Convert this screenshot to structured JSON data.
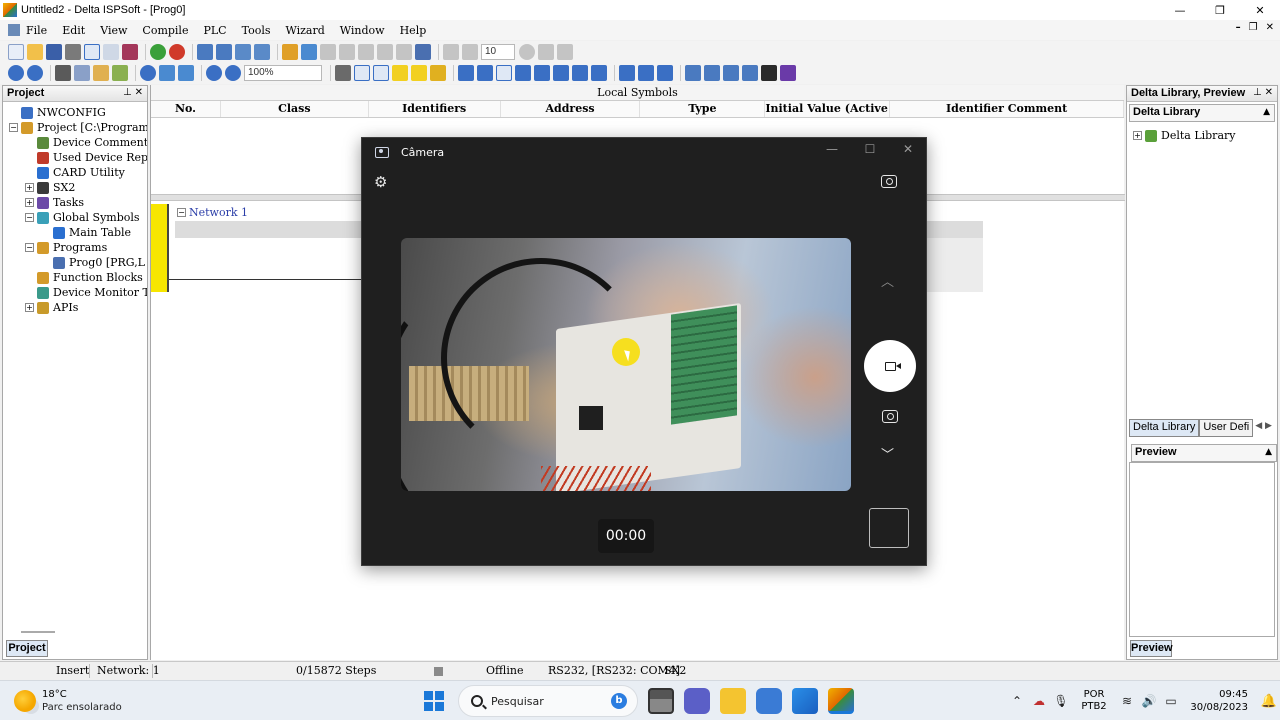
{
  "window": {
    "title": "Untitled2 - Delta ISPSoft - [Prog0]"
  },
  "menu": {
    "items": [
      "File",
      "Edit",
      "View",
      "Compile",
      "PLC",
      "Tools",
      "Wizard",
      "Window",
      "Help"
    ]
  },
  "toolbar": {
    "step_value": "10",
    "zoom_value": "100%"
  },
  "project_panel": {
    "title": "Project",
    "tab_label": "Project",
    "tree": [
      {
        "label": "NWCONFIG",
        "indent": 0,
        "expander": "",
        "icon_color": "#3a6fc4"
      },
      {
        "label": "Project [C:\\ProgramData\\",
        "indent": 0,
        "expander": "-",
        "icon_color": "#d39a2a"
      },
      {
        "label": "Device Comment L",
        "indent": 1,
        "expander": "",
        "icon_color": "#5a8a3c"
      },
      {
        "label": "Used Device Repor",
        "indent": 1,
        "expander": "",
        "icon_color": "#c03a2a"
      },
      {
        "label": "CARD Utility",
        "indent": 1,
        "expander": "",
        "icon_color": "#2a6fd0"
      },
      {
        "label": "SX2",
        "indent": 1,
        "expander": "+",
        "icon_color": "#3a3a3a"
      },
      {
        "label": "Tasks",
        "indent": 1,
        "expander": "+",
        "icon_color": "#6c4aa8"
      },
      {
        "label": "Global Symbols",
        "indent": 1,
        "expander": "-",
        "icon_color": "#3aa0b8"
      },
      {
        "label": "Main Table",
        "indent": 2,
        "expander": "",
        "icon_color": "#2a6fd0"
      },
      {
        "label": "Programs",
        "indent": 1,
        "expander": "-",
        "icon_color": "#d39a2a"
      },
      {
        "label": "Prog0 [PRG,L",
        "indent": 2,
        "expander": "",
        "icon_color": "#4a6fb0"
      },
      {
        "label": "Function Blocks",
        "indent": 1,
        "expander": "",
        "icon_color": "#d39a2a"
      },
      {
        "label": "Device Monitor Ta",
        "indent": 1,
        "expander": "",
        "icon_color": "#3a9a8a"
      },
      {
        "label": "APIs",
        "indent": 1,
        "expander": "+",
        "icon_color": "#c89a2a"
      }
    ]
  },
  "editor": {
    "local_symbols_title": "Local Symbols",
    "columns": [
      {
        "label": "No.",
        "w": 70
      },
      {
        "label": "Class",
        "w": 148
      },
      {
        "label": "Identifiers",
        "w": 132
      },
      {
        "label": "Address",
        "w": 140
      },
      {
        "label": "Type",
        "w": 125
      },
      {
        "label": "Initial Value (Active whe...",
        "w": 125
      },
      {
        "label": "Identifier Comment",
        "w": 234
      }
    ],
    "network_label": "Network 1"
  },
  "library_panel": {
    "title": "Delta Library, Preview",
    "combo_label": "Delta Library",
    "tree_root": "Delta Library",
    "tab_delta": "Delta Library",
    "tab_user": "User Defi",
    "preview_combo": "Preview",
    "preview_tab": "Preview"
  },
  "statusbar": {
    "mode": "Insert",
    "network": "Network: 1",
    "steps": "0/15872 Steps",
    "connection": "Offline",
    "comm": "RS232, [RS232: COM4]",
    "device": "SX2"
  },
  "camera": {
    "title": "Câmera",
    "timer": "00:00"
  },
  "taskbar": {
    "temperature": "18°C",
    "weather": "Parc ensolarado",
    "search_placeholder": "Pesquisar",
    "lang_line1": "POR",
    "lang_line2": "PTB2",
    "time": "09:45",
    "date": "30/08/2023"
  }
}
